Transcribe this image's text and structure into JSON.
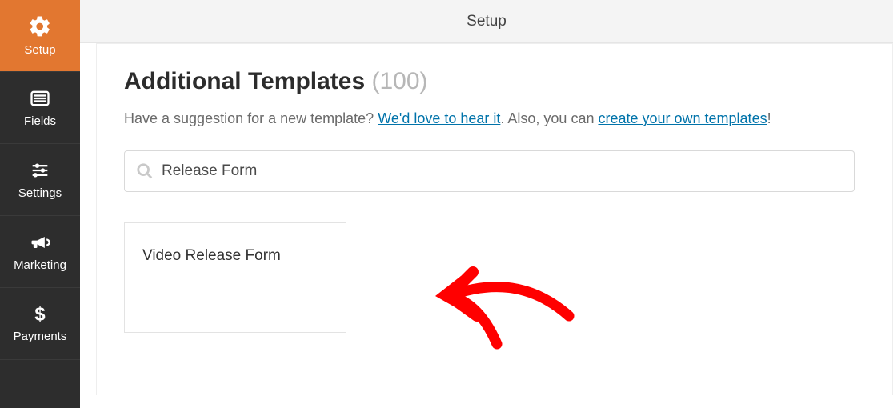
{
  "topbar": {
    "title": "Setup"
  },
  "sidebar": {
    "items": [
      {
        "label": "Setup"
      },
      {
        "label": "Fields"
      },
      {
        "label": "Settings"
      },
      {
        "label": "Marketing"
      },
      {
        "label": "Payments"
      }
    ]
  },
  "main": {
    "heading": "Additional Templates",
    "count": "(100)",
    "subtext_prefix": "Have a suggestion for a new template? ",
    "link1": "We'd love to hear it",
    "subtext_mid": ". Also, you can ",
    "link2": "create your own templates",
    "subtext_suffix": "!",
    "search_value": "Release Form"
  },
  "templates": [
    {
      "title": "Video Release Form"
    }
  ]
}
